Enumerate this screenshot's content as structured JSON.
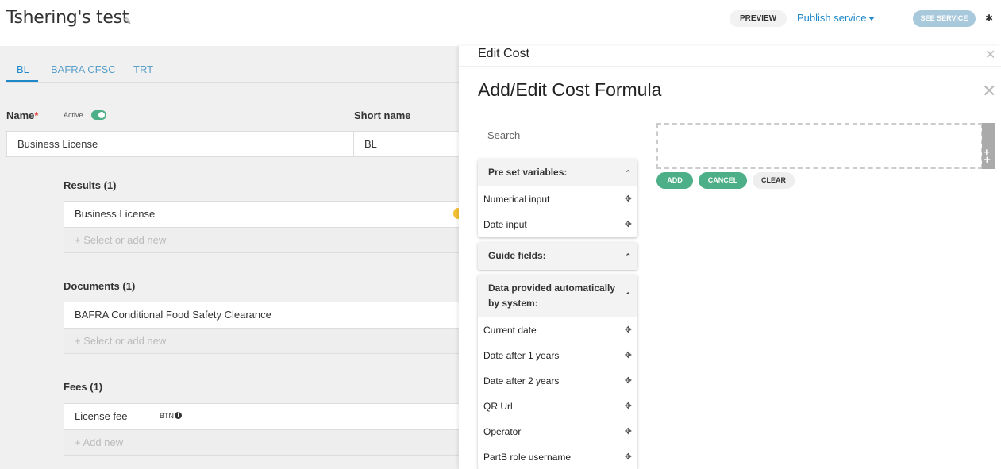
{
  "header": {
    "title": "Tshering's test",
    "preview": "PREVIEW",
    "publish": "Publish service",
    "see_service": "SEE SERVICE",
    "pencil_icon": "✎",
    "gear_icon": "✱"
  },
  "tabs": [
    "BL",
    "BAFRA CFSC",
    "TRT"
  ],
  "form": {
    "name_label": "Name",
    "required": "*",
    "active_label": "Active",
    "name_value": "Business License",
    "short_name_label": "Short name",
    "short_name_value": "BL"
  },
  "results": {
    "label": "Results (1)",
    "item": "Business License",
    "add": "+ Select or add new"
  },
  "documents": {
    "label": "Documents (1)",
    "item": "BAFRA Conditional Food Safety Clearance",
    "add": "+ Select or add new"
  },
  "fees": {
    "label": "Fees (1)",
    "item": "License fee",
    "currency": "BTN",
    "info": "i",
    "add": "+ Add new"
  },
  "panel": {
    "edit_cost": "Edit Cost",
    "formula_title": "Add/Edit Cost Formula",
    "close": "✕",
    "search_placeholder": "Search",
    "preset": {
      "title": "Pre set variables:",
      "items": [
        "Numerical input",
        "Date input"
      ]
    },
    "guide": {
      "title": "Guide fields:"
    },
    "system": {
      "title": "Data provided automatically by system:",
      "items": [
        "Current date",
        "Date after 1 years",
        "Date after 2 years",
        "QR Url",
        "Operator",
        "PartB role username"
      ]
    },
    "caret": "⌃",
    "move_icon": "✥",
    "add": "ADD",
    "cancel": "CANCEL",
    "clear": "CLEAR",
    "plus": "+"
  }
}
